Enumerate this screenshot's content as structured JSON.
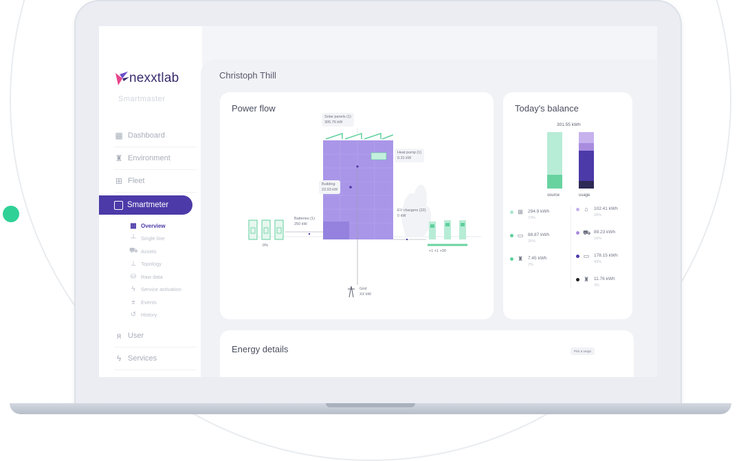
{
  "brand": {
    "name": "nexxtlab",
    "product": "Smartmaster",
    "accent": "#4c3aa8",
    "brand_pink": "#e8458b"
  },
  "sidebar": {
    "items_top": [
      {
        "label": "Dashboard",
        "icon": "dashboard-icon"
      },
      {
        "label": "Environment",
        "icon": "environment-icon"
      },
      {
        "label": "Fleet",
        "icon": "fleet-icon"
      }
    ],
    "active": {
      "label": "Smartmeter",
      "icon": "smartmeter-icon"
    },
    "subitems": [
      {
        "label": "Overview",
        "icon": "overview-icon",
        "active": true
      },
      {
        "label": "Single line",
        "icon": "single-line-icon"
      },
      {
        "label": "Assets",
        "icon": "assets-icon"
      },
      {
        "label": "Topology",
        "icon": "topology-icon"
      },
      {
        "label": "Raw data",
        "icon": "database-icon"
      },
      {
        "label": "Service activation",
        "icon": "service-activation-icon"
      },
      {
        "label": "Events",
        "icon": "events-icon"
      },
      {
        "label": "History",
        "icon": "history-icon"
      }
    ],
    "items_bottom": [
      {
        "label": "User",
        "icon": "user-icon"
      },
      {
        "label": "Services",
        "icon": "services-icon"
      }
    ]
  },
  "page": {
    "title": "Christoph Thill"
  },
  "power_flow": {
    "title": "Power flow",
    "solar": {
      "label": "Solar panels (1)",
      "value": "305.76 kW"
    },
    "heat_pump": {
      "label": "Heat pump (1)",
      "value": "0.31 kW"
    },
    "building": {
      "label": "Building",
      "value": "23.93 kW"
    },
    "batteries": {
      "label": "Batteries (1)",
      "value": "250 kW",
      "soc": "0%"
    },
    "ev_chargers": {
      "label": "EV chargers (22)",
      "value": "0 kW",
      "groups": "+1  +1  +30"
    },
    "grid": {
      "label": "Grid",
      "value": "XX kW"
    }
  },
  "balance": {
    "title": "Today's balance",
    "total": "301.55 kWh",
    "source_label": "source",
    "usage_label": "usage",
    "source_left": [
      {
        "value": "294.9 kWh",
        "pct": "73%",
        "color": "#a8e8cf",
        "icon": "solar-panel-icon"
      },
      {
        "value": "88.87 kWh",
        "pct": "25%",
        "color": "#5fcf9c",
        "icon": "battery-icon"
      },
      {
        "value": "7.45 kWh",
        "pct": "2%",
        "color": "#5fcf9c",
        "icon": "grid-tower-icon"
      }
    ],
    "usage_right": [
      {
        "value": "102.41 kWh",
        "pct": "28%",
        "color": "#c7b2ee",
        "icon": "building-icon"
      },
      {
        "value": "89.23 kWh",
        "pct": "18%",
        "color": "#a98cdf",
        "icon": "car-icon"
      },
      {
        "value": "178.15 kWh",
        "pct": "49%",
        "color": "#4c3aa8",
        "icon": "battery-icon"
      },
      {
        "value": "11.76 kWh",
        "pct": "3%",
        "color": "#222222",
        "icon": "grid-tower-icon"
      }
    ],
    "bars": {
      "source_fractions": [
        0.75,
        0.25
      ],
      "source_colors": [
        "#b7ecd6",
        "#69d3a0"
      ],
      "usage_fractions": [
        0.2,
        0.13,
        0.53,
        0.14
      ],
      "usage_colors": [
        "#c7b2ee",
        "#a98cdf",
        "#4c3aa8",
        "#2d2a55"
      ]
    }
  },
  "energy": {
    "title": "Energy details",
    "range_button": "Pick a range"
  }
}
